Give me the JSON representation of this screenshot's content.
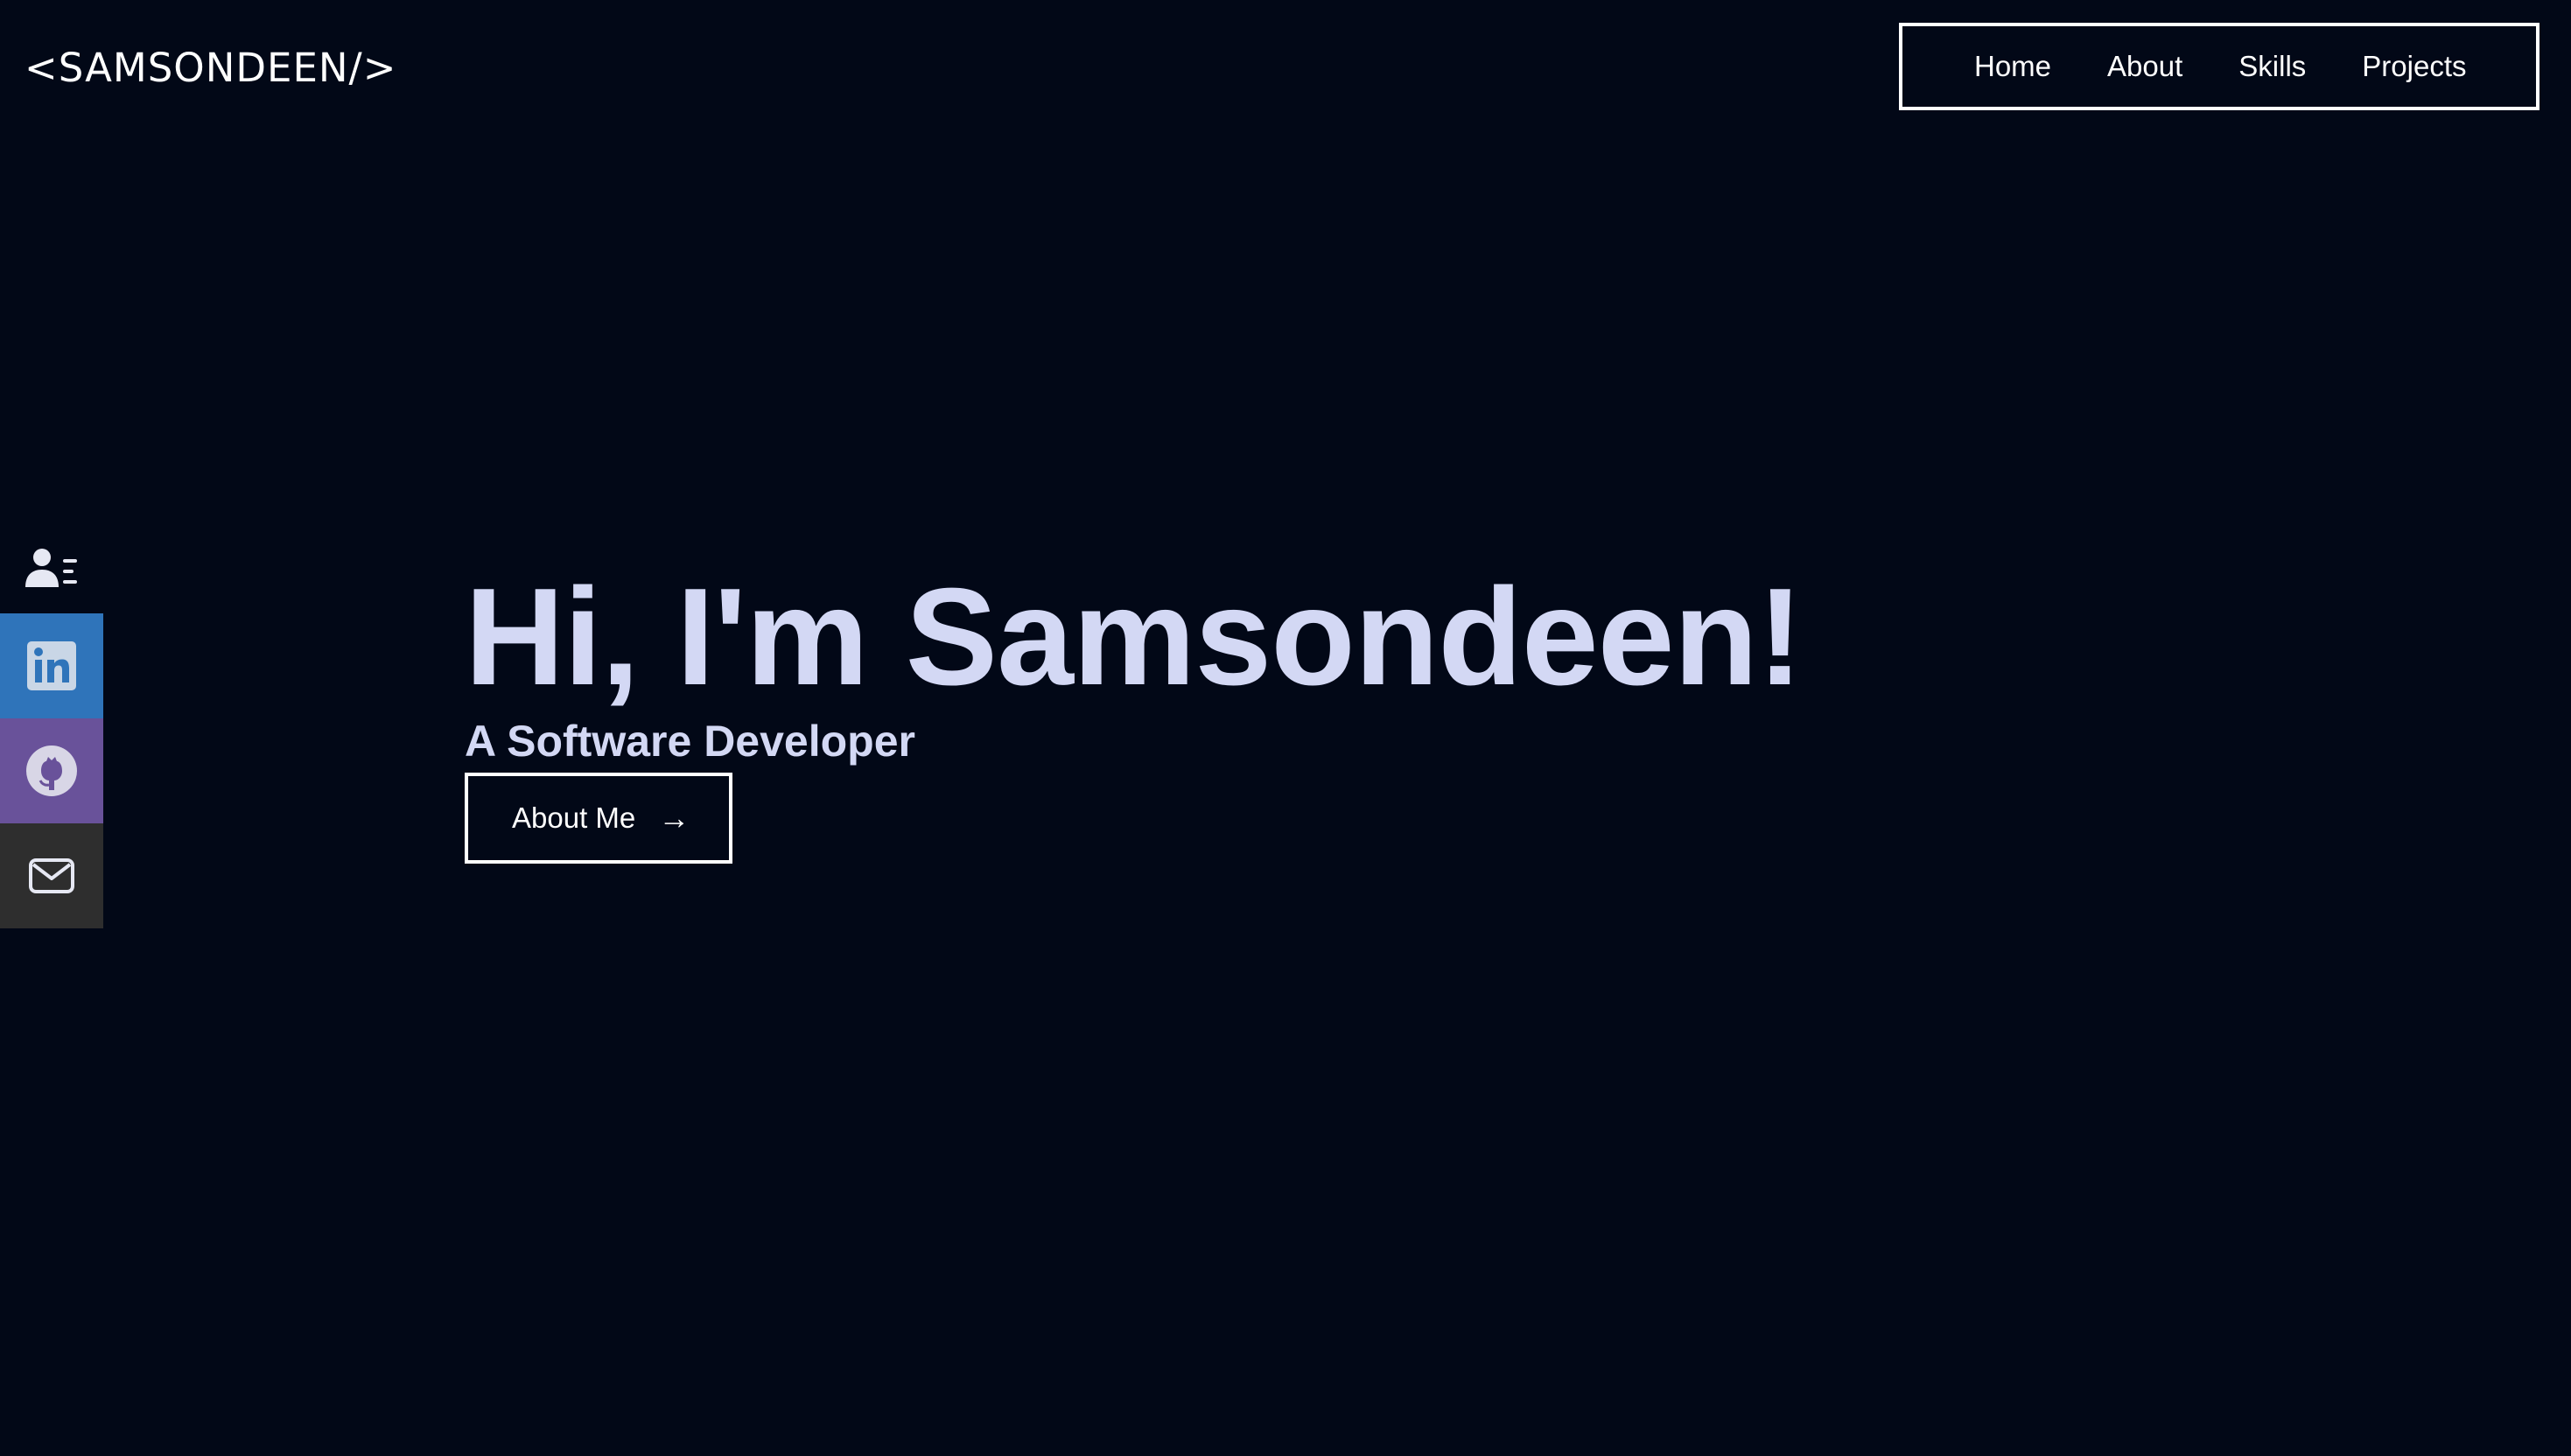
{
  "header": {
    "logo_text": "<SAMSONDEEN/>",
    "nav": [
      {
        "label": "Home"
      },
      {
        "label": "About"
      },
      {
        "label": "Skills"
      },
      {
        "label": "Projects"
      }
    ]
  },
  "sidebar": {
    "icons": [
      {
        "name": "contact-card-icon"
      },
      {
        "name": "linkedin-icon",
        "color": "#2f74ba"
      },
      {
        "name": "github-icon",
        "color": "#69529a"
      },
      {
        "name": "mail-icon",
        "color": "#2e2e2e"
      }
    ]
  },
  "hero": {
    "title": "Hi, I'm Samsondeen!",
    "subtitle": "A Software Developer",
    "button_label": "About Me",
    "button_icon": "arrow-right-icon"
  },
  "colors": {
    "background": "#020817",
    "accent_text": "#d3d8f4",
    "white": "#ffffff"
  }
}
